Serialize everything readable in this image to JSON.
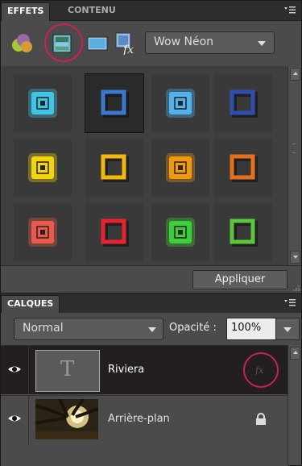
{
  "effects_panel": {
    "tabs": [
      {
        "label": "EFFETS",
        "active": true
      },
      {
        "label": "CONTENU",
        "active": false
      }
    ],
    "menu_icon": "panel-menu-icon",
    "toolbar": {
      "tools": [
        {
          "name": "layer-styles-icon"
        },
        {
          "name": "filters-icon",
          "selected": true
        },
        {
          "name": "photo-effects-icon"
        },
        {
          "name": "fx-icon"
        }
      ],
      "category_dropdown": {
        "value": "Wow Néon"
      }
    },
    "swatches": [
      {
        "color": "#3fc4e8",
        "style": "glow"
      },
      {
        "color": "#3b78d0",
        "style": "outline"
      },
      {
        "color": "#4fb2ea",
        "style": "glow"
      },
      {
        "color": "#2f4fb0",
        "style": "outline"
      },
      {
        "color": "#f4d40c",
        "style": "glow"
      },
      {
        "color": "#f2b90a",
        "style": "outline"
      },
      {
        "color": "#f29a0e",
        "style": "glow"
      },
      {
        "color": "#e6701a",
        "style": "outline"
      },
      {
        "color": "#ea5a4a",
        "style": "glow"
      },
      {
        "color": "#e6222e",
        "style": "outline"
      },
      {
        "color": "#3ccf3a",
        "style": "glow"
      },
      {
        "color": "#5cc63a",
        "style": "outline"
      }
    ],
    "apply_label": "Appliquer"
  },
  "layers_panel": {
    "tab_label": "CALQUES",
    "blend_mode": "Normal",
    "opacity_label": "Opacité :",
    "opacity_value": "100%",
    "layers": [
      {
        "name": "Riviera",
        "type": "text",
        "thumb_glyph": "T",
        "selected": true,
        "badge_icon": "fx-badge-icon"
      },
      {
        "name": "Arrière-plan",
        "type": "image",
        "selected": false,
        "badge_icon": "lock-icon"
      }
    ]
  },
  "colors": {
    "highlight_circle": "#c8205a",
    "panel_bg": "#4b4b4b",
    "tab_bar_bg": "#2d2d2d"
  }
}
